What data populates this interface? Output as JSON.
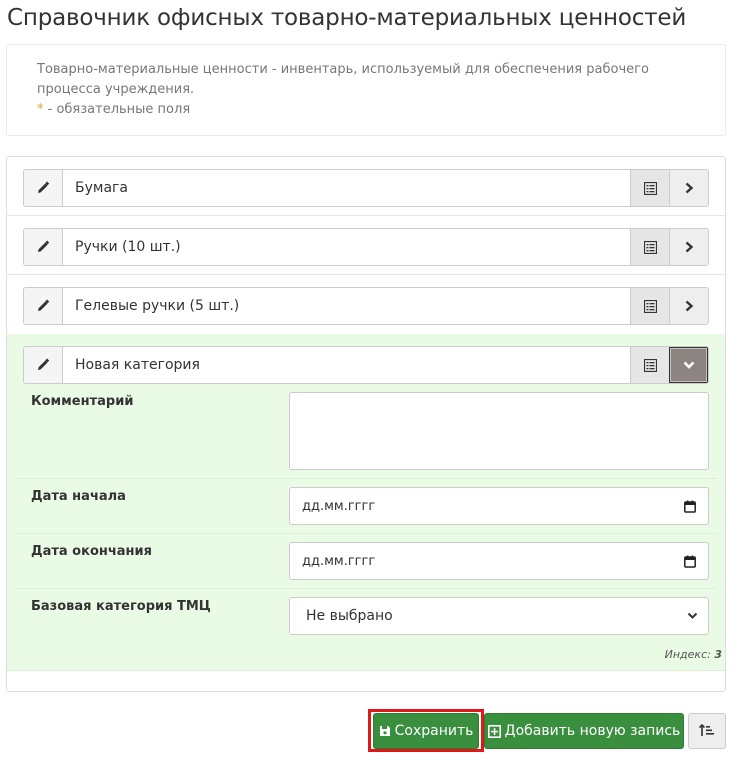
{
  "page": {
    "title": "Справочник офисных товарно-материальных ценностей",
    "description": "Товарно-материальные ценности - инвентарь, используемый для обеспечения рабочего процесса учреждения.",
    "required_star": "*",
    "required_note": " - обязательные поля"
  },
  "categories": [
    {
      "name": "Бумага",
      "expanded": false
    },
    {
      "name": "Ручки (10 шт.)",
      "expanded": false
    },
    {
      "name": "Гелевые ручки (5 шт.)",
      "expanded": false
    },
    {
      "name": "Новая категория",
      "expanded": true
    }
  ],
  "form": {
    "comment_label": "Комментарий",
    "comment_value": "",
    "start_date_label": "Дата начала",
    "start_date_placeholder": "дд.мм.гггг",
    "end_date_label": "Дата окончания",
    "end_date_placeholder": "дд.мм.гггг",
    "base_category_label": "Базовая категория ТМЦ",
    "base_category_selected": "Не выбрано",
    "index_label": "Индекс:",
    "index_value": "3"
  },
  "actions": {
    "save_label": "Сохранить",
    "add_label": "Добавить новую запись"
  },
  "icons": {
    "edit": "pencil-icon",
    "list": "list-icon",
    "expand": "chevron-right-icon",
    "collapse": "chevron-down-icon",
    "calendar": "calendar-icon",
    "save": "floppy-disk-icon",
    "add": "plus-square-icon",
    "sort": "sort-amount-icon"
  },
  "colors": {
    "active_row_bg": "#eafbe5",
    "primary_button": "#3a8f3f",
    "highlight_border": "#e01818",
    "required_star": "#e09e2d"
  }
}
